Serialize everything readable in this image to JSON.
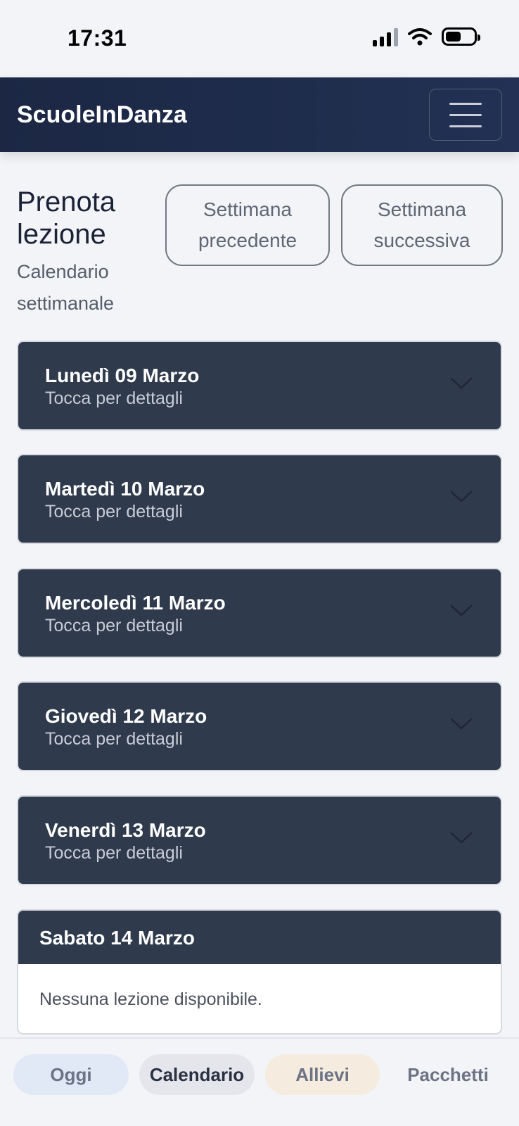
{
  "status_bar": {
    "time": "17:31"
  },
  "navbar": {
    "brand": "ScuoleInDanza"
  },
  "header": {
    "title": "Prenota lezione",
    "subtitle": "Calendario settimanale",
    "prev_week_label": "Settimana precedente",
    "next_week_label": "Settimana successiva"
  },
  "days": [
    {
      "name": "Lunedì 09 Marzo",
      "hint": "Tocca per dettagli"
    },
    {
      "name": "Martedì 10 Marzo",
      "hint": "Tocca per dettagli"
    },
    {
      "name": "Mercoledì 11 Marzo",
      "hint": "Tocca per dettagli"
    },
    {
      "name": "Giovedì 12 Marzo",
      "hint": "Tocca per dettagli"
    },
    {
      "name": "Venerdì 13 Marzo",
      "hint": "Tocca per dettagli"
    }
  ],
  "saturday": {
    "name": "Sabato 14 Marzo",
    "message": "Nessuna lezione disponibile."
  },
  "bottom_nav": {
    "tabs": [
      {
        "label": "Oggi"
      },
      {
        "label": "Calendario"
      },
      {
        "label": "Allievi"
      },
      {
        "label": "Pacchetti"
      }
    ],
    "active": "Calendario"
  },
  "colors": {
    "navbar": "#1b2743",
    "card": "#2f3a4c",
    "background": "#f3f4f8"
  }
}
